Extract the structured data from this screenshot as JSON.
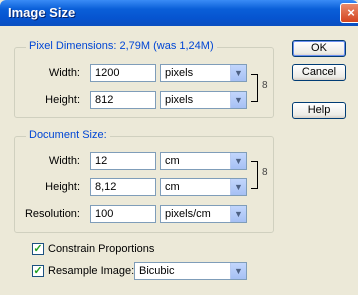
{
  "window": {
    "title": "Image Size",
    "close_glyph": "×"
  },
  "pixel_dimensions": {
    "legend": "Pixel Dimensions:  2,79M (was 1,24M)",
    "width_label": "Width:",
    "width_value": "1200",
    "width_unit": "pixels",
    "height_label": "Height:",
    "height_value": "812",
    "height_unit": "pixels"
  },
  "document_size": {
    "legend": "Document Size:",
    "width_label": "Width:",
    "width_value": "12",
    "width_unit": "cm",
    "height_label": "Height:",
    "height_value": "8,12",
    "height_unit": "cm",
    "resolution_label": "Resolution:",
    "resolution_value": "100",
    "resolution_unit": "pixels/cm"
  },
  "options": {
    "constrain_label": "Constrain Proportions",
    "constrain_checked": true,
    "resample_label": "Resample Image:",
    "resample_checked": true,
    "resample_method": "Bicubic"
  },
  "buttons": {
    "ok": "OK",
    "cancel": "Cancel",
    "help": "Help"
  },
  "icons": {
    "dropdown_arrow": "▼",
    "chain_link": "8",
    "checkmark": "✓"
  }
}
